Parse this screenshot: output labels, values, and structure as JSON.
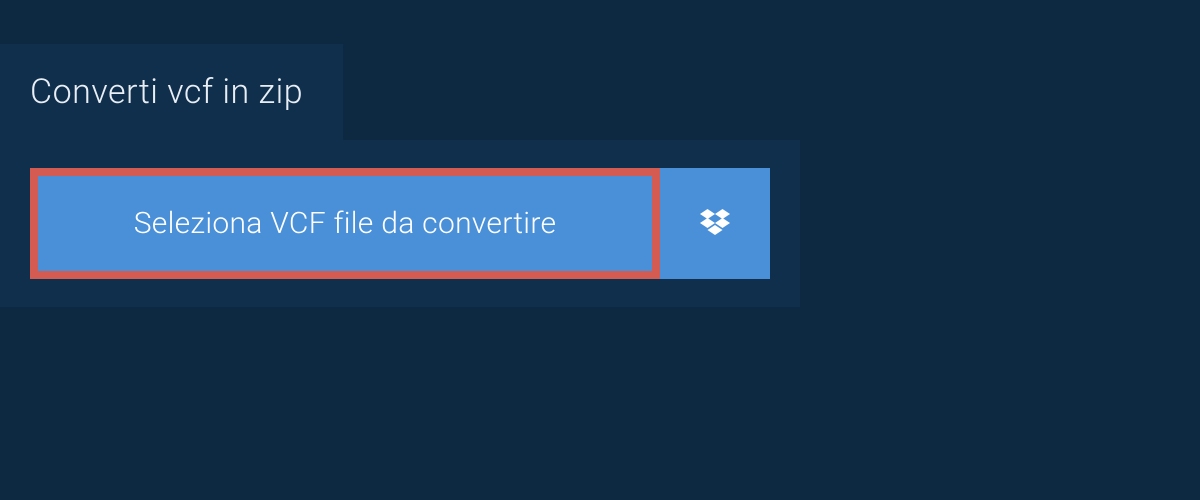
{
  "header": {
    "title": "Converti vcf in zip"
  },
  "buttons": {
    "select_file_label": "Seleziona VCF file da convertire",
    "dropbox_icon_name": "dropbox-icon"
  },
  "colors": {
    "background": "#0d2841",
    "panel": "#102f4c",
    "button_primary": "#4a90d9",
    "highlight_border": "#d35b52",
    "text_light": "#e8eef4",
    "text_white": "#ffffff"
  }
}
